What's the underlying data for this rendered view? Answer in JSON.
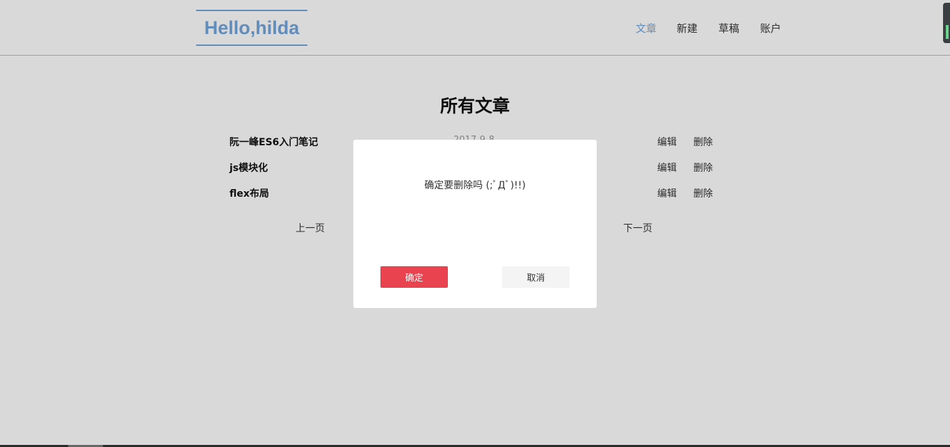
{
  "header": {
    "logo": "Hello,hilda",
    "nav": [
      {
        "label": "文章",
        "active": true
      },
      {
        "label": "新建",
        "active": false
      },
      {
        "label": "草稿",
        "active": false
      },
      {
        "label": "账户",
        "active": false
      }
    ]
  },
  "main": {
    "title": "所有文章",
    "articles": [
      {
        "title": "阮一峰ES6入门笔记",
        "date": "2017-9-8",
        "edit": "编辑",
        "delete": "删除"
      },
      {
        "title": "js模块化",
        "date": "",
        "edit": "编辑",
        "delete": "删除"
      },
      {
        "title": "flex布局",
        "date": "",
        "edit": "编辑",
        "delete": "删除"
      }
    ],
    "pager": {
      "prev": "上一页",
      "next": "下一页"
    }
  },
  "modal": {
    "message": "确定要删除吗 (;ﾟДﾟ)!!)",
    "confirm": "确定",
    "cancel": "取消"
  },
  "colors": {
    "accent": "#74a5db",
    "danger": "#e8434f",
    "overlay": "rgba(0,0,0,0.15)"
  }
}
